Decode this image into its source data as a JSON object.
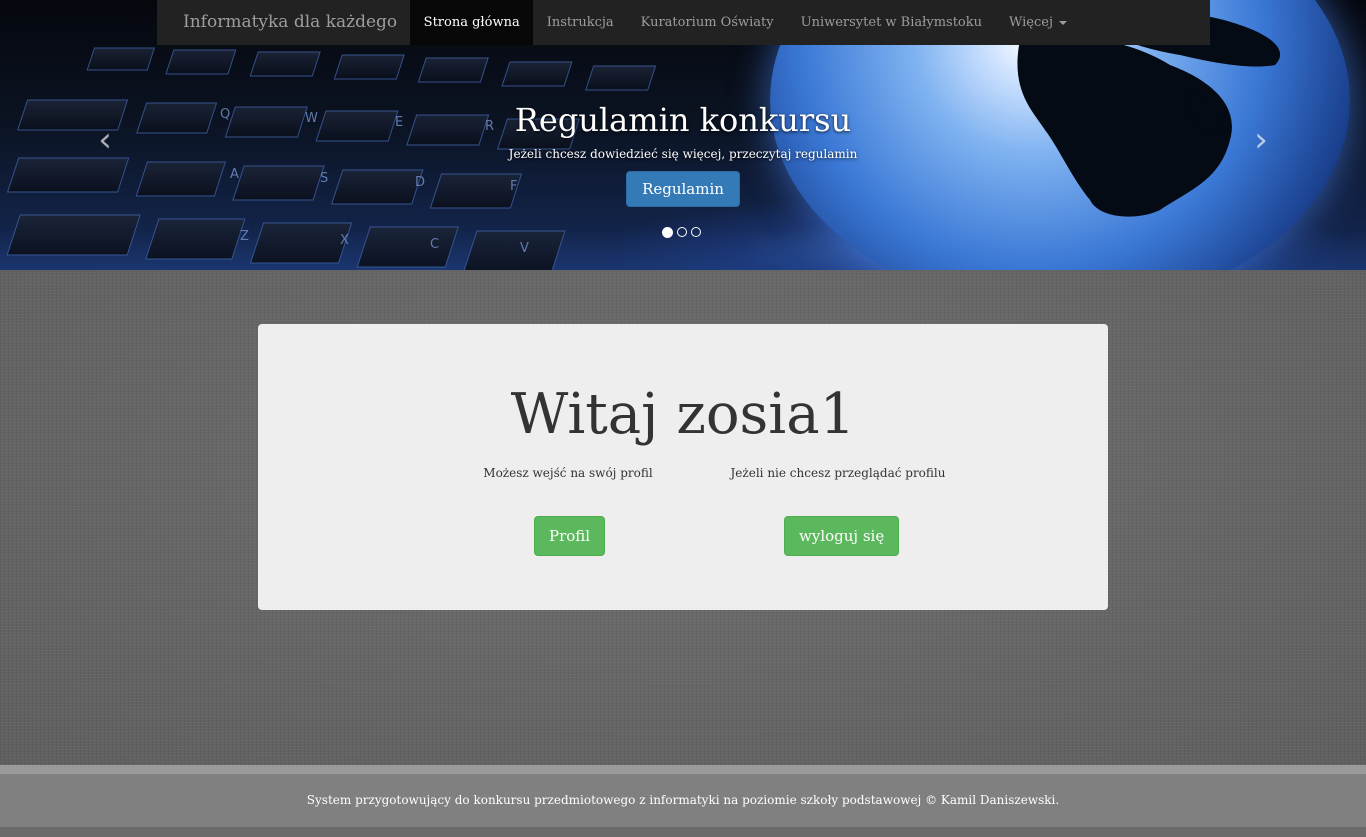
{
  "navbar": {
    "brand": "Informatyka dla każdego",
    "items": [
      {
        "label": "Strona główna",
        "active": true
      },
      {
        "label": "Instrukcja"
      },
      {
        "label": "Kuratorium Oświaty"
      },
      {
        "label": "Uniwersytet w Białymstoku"
      },
      {
        "label": "Więcej",
        "dropdown": true
      }
    ]
  },
  "carousel": {
    "title": "Regulamin konkursu",
    "subtitle": "Jeżeli chcesz dowiedzieć się więcej, przeczytaj regulamin",
    "button_label": "Regulamin",
    "prev_icon": "‹",
    "next_icon": "›",
    "slides_count": 3,
    "active_slide": 1
  },
  "welcome": {
    "title": "Witaj zosia1",
    "left_text": "Możesz wejść na swój profil",
    "right_text": "Jeżeli nie chcesz przeglądać profilu",
    "profile_button": "Profil",
    "logout_button": "wyloguj się"
  },
  "footer": {
    "text": "System przygotowujący do konkursu przedmiotowego z informatyki na poziomie szkoły podstawowej © Kamil Daniszewski."
  },
  "colors": {
    "navbar_bg": "#222222",
    "primary": "#337ab7",
    "success": "#5cb85c",
    "panel_bg": "#eeeeee"
  }
}
